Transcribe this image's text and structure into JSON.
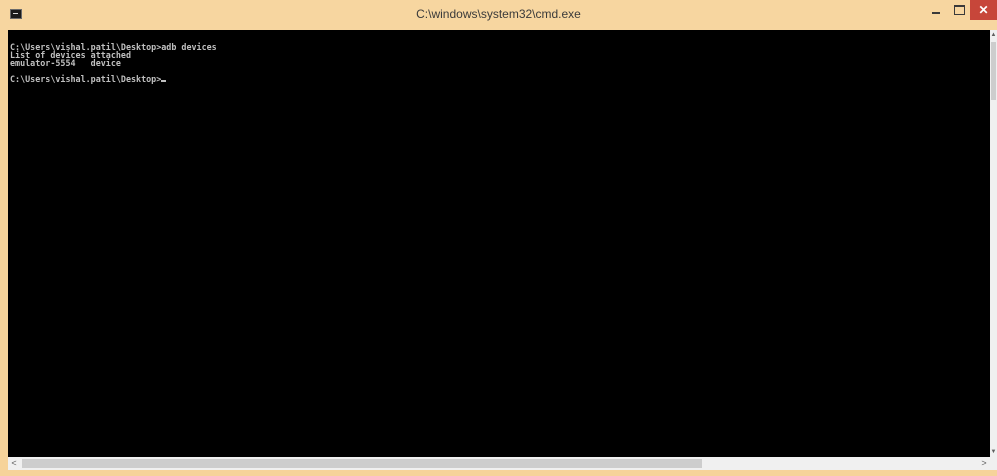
{
  "window": {
    "title": "C:\\windows\\system32\\cmd.exe",
    "minimize_icon": "minimize-icon",
    "maximize_icon": "maximize-icon",
    "close_label": "✕"
  },
  "console": {
    "lines": [
      "C:\\Users\\vishal.patil\\Desktop>adb devices",
      "List of devices attached",
      "emulator-5554   device",
      "",
      "C:\\Users\\vishal.patil\\Desktop>"
    ]
  },
  "scrollbars": {
    "left_arrow": "<",
    "right_arrow": ">",
    "up_arrow": "▲",
    "down_arrow": "▼"
  },
  "colors": {
    "titlebar": "#f7d6a0",
    "console_bg": "#000000",
    "console_fg": "#c0c0c0",
    "close_button": "#c7463a"
  }
}
